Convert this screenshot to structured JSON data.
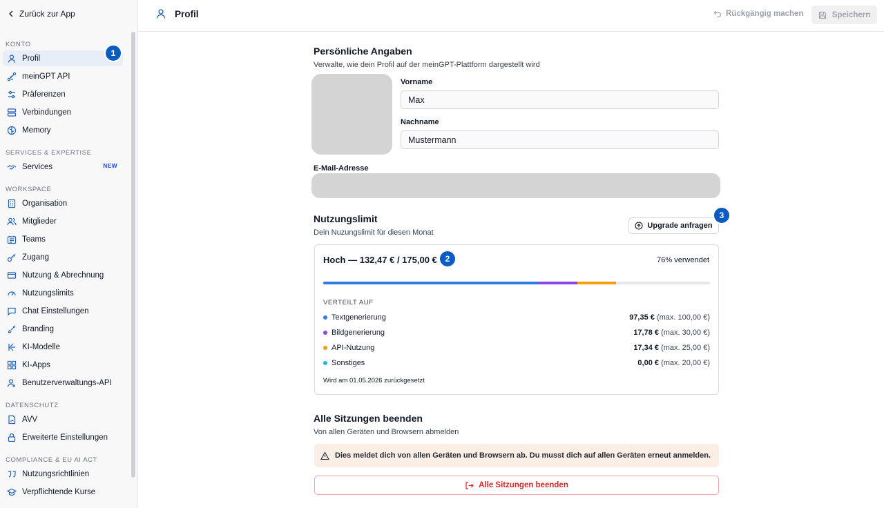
{
  "sidebar": {
    "back_label": "Zurück zur App",
    "sections": [
      {
        "label": "KONTO"
      },
      {
        "label": "SERVICES & EXPERTISE"
      },
      {
        "label": "WORKSPACE"
      },
      {
        "label": "DATENSCHUTZ"
      },
      {
        "label": "COMPLIANCE & EU AI ACT"
      }
    ],
    "items": [
      {
        "label": "Profil",
        "icon": "user-icon"
      },
      {
        "label": "meinGPT API",
        "icon": "api-icon"
      },
      {
        "label": "Präferenzen",
        "icon": "sliders-icon"
      },
      {
        "label": "Verbindungen",
        "icon": "server-icon"
      },
      {
        "label": "Memory",
        "icon": "brain-icon"
      },
      {
        "label": "Services",
        "icon": "handshake-icon",
        "badge": "NEW"
      },
      {
        "label": "Organisation",
        "icon": "building-icon"
      },
      {
        "label": "Mitglieder",
        "icon": "users-icon"
      },
      {
        "label": "Teams",
        "icon": "team-icon"
      },
      {
        "label": "Zugang",
        "icon": "key-icon"
      },
      {
        "label": "Nutzung & Abrechnung",
        "icon": "credit-card-icon"
      },
      {
        "label": "Nutzungslimits",
        "icon": "gauge-icon"
      },
      {
        "label": "Chat Einstellungen",
        "icon": "chat-icon"
      },
      {
        "label": "Branding",
        "icon": "brush-icon"
      },
      {
        "label": "KI-Modelle",
        "icon": "model-icon"
      },
      {
        "label": "KI-Apps",
        "icon": "apps-icon"
      },
      {
        "label": "Benutzerverwaltungs-API",
        "icon": "user-api-icon"
      },
      {
        "label": "AVV",
        "icon": "contract-icon"
      },
      {
        "label": "Erweiterte Einstellungen",
        "icon": "lock-icon"
      },
      {
        "label": "Nutzungsrichtlinien",
        "icon": "quote-icon"
      },
      {
        "label": "Verpflichtende Kurse",
        "icon": "graduation-cap-icon"
      }
    ]
  },
  "header": {
    "title": "Profil",
    "undo_label": "Rückgängig machen",
    "save_label": "Speichern"
  },
  "steps": [
    "1",
    "2",
    "3"
  ],
  "profile": {
    "heading": "Persönliche Angaben",
    "description": "Verwalte, wie dein Profil auf der meinGPT-Plattform dargestellt wird",
    "first_name_label": "Vorname",
    "first_name_value": "Max",
    "last_name_label": "Nachname",
    "last_name_value": "Mustermann",
    "email_label": "E-Mail-Adresse"
  },
  "usage": {
    "heading": "Nutzungslimit",
    "description": "Dein Nuzungslimit für diesen Monat",
    "upgrade_label": "Upgrade anfragen",
    "summary": "Hoch — 132,47 € / 175,00 €",
    "percent_label": "76% verwendet",
    "distribution_label": "VERTEILT AUF",
    "segments": [
      {
        "name": "Textgenerierung",
        "amount": "97,35 €",
        "max": "(max. 100,00 €)",
        "value": 97.35,
        "color": "#2f7ae5"
      },
      {
        "name": "Bildgenerierung",
        "amount": "17,78 €",
        "max": "(max. 30,00 €)",
        "value": 17.78,
        "color": "#8b45e6"
      },
      {
        "name": "API-Nutzung",
        "amount": "17,34 €",
        "max": "(max. 25,00 €)",
        "value": 17.34,
        "color": "#f59e0b"
      },
      {
        "name": "Sonstiges",
        "amount": "0,00 €",
        "max": "(max. 20,00 €)",
        "value": 0,
        "color": "#22b8cf"
      }
    ],
    "total_limit": 175,
    "reset_text": "Wird am 01.05.2026 zurückgesetzt"
  },
  "sessions": {
    "heading": "Alle Sitzungen beenden",
    "description": "Von allen Geräten und Browsern abmelden",
    "warning": "Dies meldet dich von allen Geräten und Browsern ab. Du musst dich auf allen Geräten erneut anmelden.",
    "button_label": "Alle Sitzungen beenden"
  }
}
